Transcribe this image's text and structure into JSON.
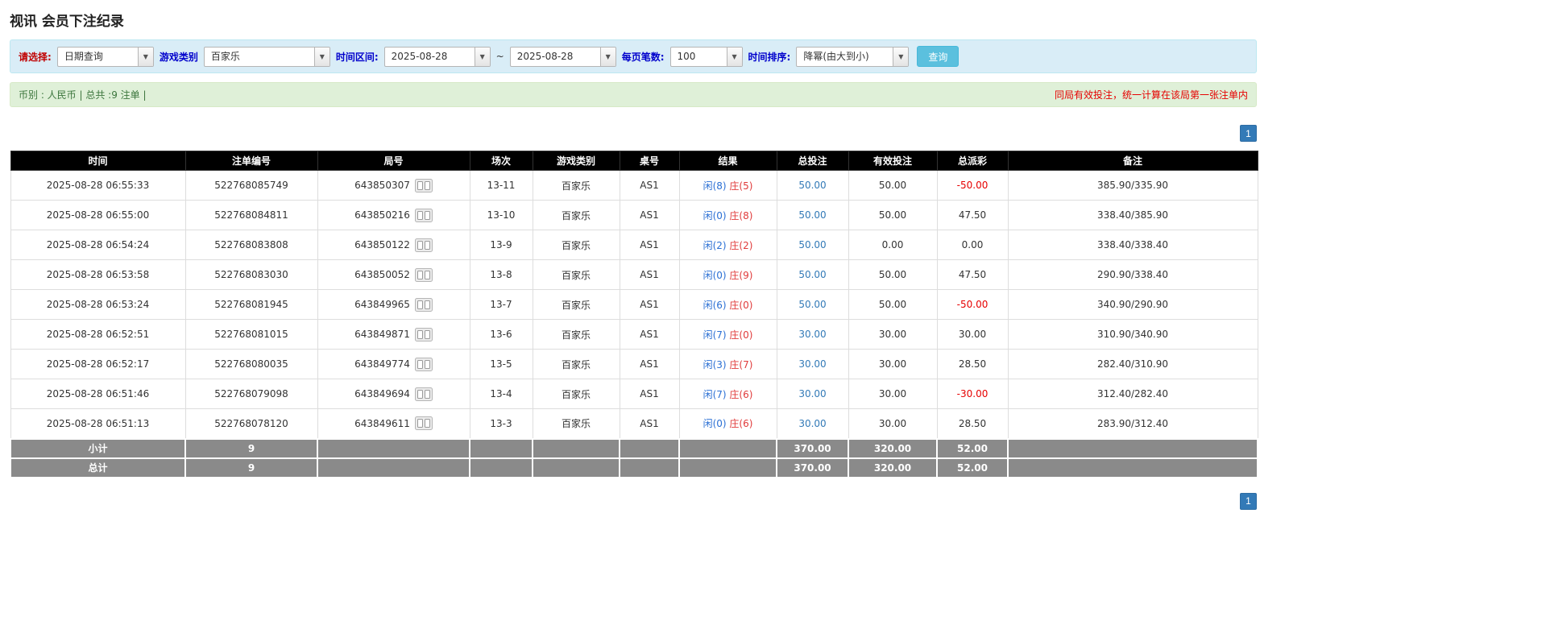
{
  "page_title": "视讯 会员下注纪录",
  "filters": {
    "select_label": "请选择:",
    "select_value": "日期查询",
    "game_type_label": "游戏类别",
    "game_type_value": "百家乐",
    "date_range_label": "时间区间:",
    "date_from": "2025-08-28",
    "date_separator": "~",
    "date_to": "2025-08-28",
    "page_size_label": "每页笔数:",
    "page_size_value": "100",
    "sort_label": "时间排序:",
    "sort_value": "降幂(由大到小)",
    "search_button": "查询"
  },
  "summary": {
    "left": "币别 : 人民币 | 总共 :9 注单 |",
    "right": "同局有效投注，统一计算在该局第一张注单内"
  },
  "pagination": {
    "page": "1"
  },
  "colors": {
    "filter_bar_bg": "#d9edf7",
    "summary_bar_bg": "#dff0d8",
    "header_bg": "#000000",
    "footer_bg": "#8a8a8a",
    "search_button_bg": "#5bc0de",
    "pager_bg": "#337ab7",
    "player_blue": "#2a6fd4",
    "banker_red": "#e03a3a",
    "negative_red": "#e60000",
    "link_blue": "#337ab7"
  },
  "table": {
    "headers": [
      "时间",
      "注单编号",
      "局号",
      "场次",
      "游戏类别",
      "桌号",
      "结果",
      "总投注",
      "有效投注",
      "总派彩",
      "备注"
    ],
    "rows": [
      {
        "time": "2025-08-28 06:55:33",
        "bet_id": "522768085749",
        "round_id": "643850307",
        "session": "13-11",
        "game": "百家乐",
        "table_no": "AS1",
        "result_player": "闲(8)",
        "result_banker": "庄(5)",
        "total_bet": "50.00",
        "valid_bet": "50.00",
        "payout": "-50.00",
        "note": "385.90/335.90"
      },
      {
        "time": "2025-08-28 06:55:00",
        "bet_id": "522768084811",
        "round_id": "643850216",
        "session": "13-10",
        "game": "百家乐",
        "table_no": "AS1",
        "result_player": "闲(0)",
        "result_banker": "庄(8)",
        "total_bet": "50.00",
        "valid_bet": "50.00",
        "payout": "47.50",
        "note": "338.40/385.90"
      },
      {
        "time": "2025-08-28 06:54:24",
        "bet_id": "522768083808",
        "round_id": "643850122",
        "session": "13-9",
        "game": "百家乐",
        "table_no": "AS1",
        "result_player": "闲(2)",
        "result_banker": "庄(2)",
        "total_bet": "50.00",
        "valid_bet": "0.00",
        "payout": "0.00",
        "note": "338.40/338.40"
      },
      {
        "time": "2025-08-28 06:53:58",
        "bet_id": "522768083030",
        "round_id": "643850052",
        "session": "13-8",
        "game": "百家乐",
        "table_no": "AS1",
        "result_player": "闲(0)",
        "result_banker": "庄(9)",
        "total_bet": "50.00",
        "valid_bet": "50.00",
        "payout": "47.50",
        "note": "290.90/338.40"
      },
      {
        "time": "2025-08-28 06:53:24",
        "bet_id": "522768081945",
        "round_id": "643849965",
        "session": "13-7",
        "game": "百家乐",
        "table_no": "AS1",
        "result_player": "闲(6)",
        "result_banker": "庄(0)",
        "total_bet": "50.00",
        "valid_bet": "50.00",
        "payout": "-50.00",
        "note": "340.90/290.90"
      },
      {
        "time": "2025-08-28 06:52:51",
        "bet_id": "522768081015",
        "round_id": "643849871",
        "session": "13-6",
        "game": "百家乐",
        "table_no": "AS1",
        "result_player": "闲(7)",
        "result_banker": "庄(0)",
        "total_bet": "30.00",
        "valid_bet": "30.00",
        "payout": "30.00",
        "note": "310.90/340.90"
      },
      {
        "time": "2025-08-28 06:52:17",
        "bet_id": "522768080035",
        "round_id": "643849774",
        "session": "13-5",
        "game": "百家乐",
        "table_no": "AS1",
        "result_player": "闲(3)",
        "result_banker": "庄(7)",
        "total_bet": "30.00",
        "valid_bet": "30.00",
        "payout": "28.50",
        "note": "282.40/310.90"
      },
      {
        "time": "2025-08-28 06:51:46",
        "bet_id": "522768079098",
        "round_id": "643849694",
        "session": "13-4",
        "game": "百家乐",
        "table_no": "AS1",
        "result_player": "闲(7)",
        "result_banker": "庄(6)",
        "total_bet": "30.00",
        "valid_bet": "30.00",
        "payout": "-30.00",
        "note": "312.40/282.40"
      },
      {
        "time": "2025-08-28 06:51:13",
        "bet_id": "522768078120",
        "round_id": "643849611",
        "session": "13-3",
        "game": "百家乐",
        "table_no": "AS1",
        "result_player": "闲(0)",
        "result_banker": "庄(6)",
        "total_bet": "30.00",
        "valid_bet": "30.00",
        "payout": "28.50",
        "note": "283.90/312.40"
      }
    ],
    "footer": [
      {
        "label": "小计",
        "count": "9",
        "total_bet": "370.00",
        "valid_bet": "320.00",
        "payout": "52.00"
      },
      {
        "label": "总计",
        "count": "9",
        "total_bet": "370.00",
        "valid_bet": "320.00",
        "payout": "52.00"
      }
    ]
  }
}
